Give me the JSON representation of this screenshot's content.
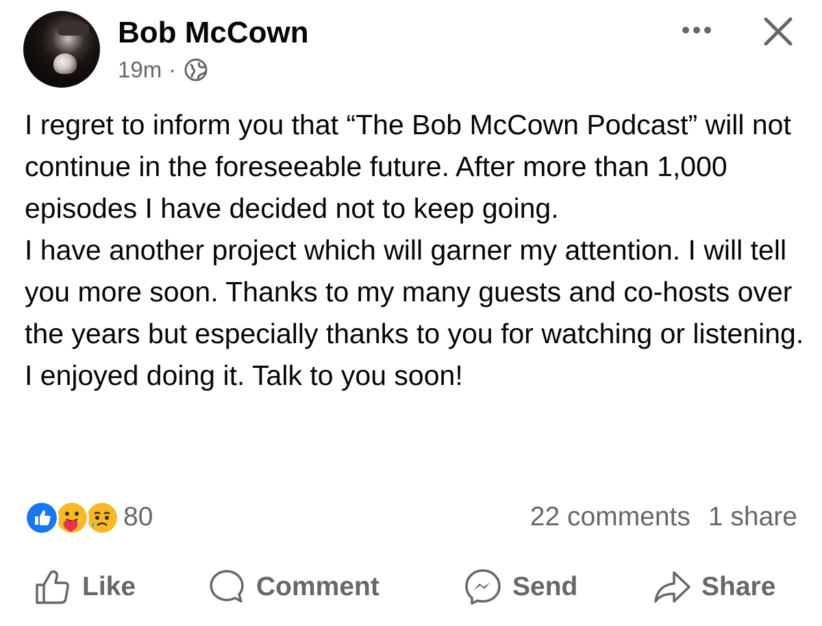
{
  "post": {
    "author": "Bob McCown",
    "time": "19m",
    "separator": "·",
    "privacy_icon": "globe-icon",
    "body": [
      "I regret to inform you that “The Bob McCown Podcast” will not continue in the foreseeable future. After more than 1,000 episodes I have decided not to keep going.",
      "I have another project which will garner my attention. I will tell you more soon. Thanks to my many guests and co-hosts over the years but especially thanks to you for watching or listening. I enjoyed doing it. Talk to you soon!"
    ]
  },
  "header_actions": {
    "more_icon": "more-options-icon",
    "close_icon": "close-icon"
  },
  "engagement": {
    "reaction_icons": [
      "like-reaction-icon",
      "care-reaction-icon",
      "sad-reaction-icon"
    ],
    "reaction_count": "80",
    "comments": "22 comments",
    "shares": "1 share"
  },
  "actions": {
    "like": "Like",
    "comment": "Comment",
    "send": "Send",
    "share": "Share"
  },
  "colors": {
    "text": "#050505",
    "secondary": "#65676b",
    "like_blue": "#1877f2",
    "reaction_yellow": "#f7b928"
  }
}
